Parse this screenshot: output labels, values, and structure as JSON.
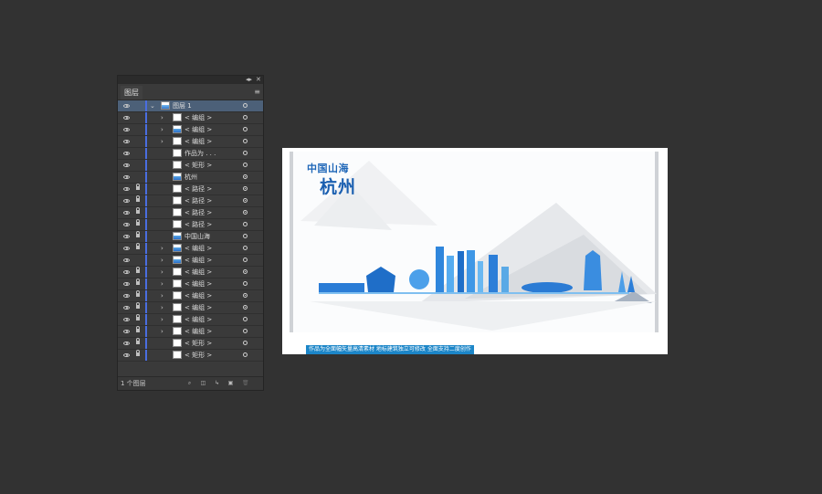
{
  "panel": {
    "tab_label": "图层",
    "collapse_icon": "double-arrow-icon",
    "close_icon": "close-icon",
    "menu_icon": "hamburger-menu-icon",
    "footer_count": "1 个图层",
    "footer_buttons": [
      "locate-object-icon",
      "make-clipping-mask-icon",
      "create-sublayer-icon",
      "new-layer-icon",
      "trash-icon"
    ]
  },
  "layers": [
    {
      "name": "图层 1",
      "top": true,
      "lock": false,
      "thumb": "blue",
      "twirl": "⌄",
      "target": "open",
      "selected": true
    },
    {
      "name": "< 编组 >",
      "lock": false,
      "thumb": "plain",
      "twirl": "›",
      "target": "open"
    },
    {
      "name": "< 编组 >",
      "lock": false,
      "thumb": "blue",
      "twirl": "›",
      "target": "open"
    },
    {
      "name": "< 编组 >",
      "lock": false,
      "thumb": "plain",
      "twirl": "›",
      "target": "open"
    },
    {
      "name": "作品为 . . .",
      "lock": false,
      "thumb": "plain",
      "twirl": "",
      "target": "open"
    },
    {
      "name": "< 矩形 >",
      "lock": false,
      "thumb": "plain",
      "twirl": "",
      "target": "open"
    },
    {
      "name": "杭州",
      "lock": false,
      "thumb": "blue",
      "twirl": "",
      "target": "filled"
    },
    {
      "name": "< 路径 >",
      "lock": true,
      "thumb": "plain",
      "twirl": "",
      "target": "filled"
    },
    {
      "name": "< 路径 >",
      "lock": true,
      "thumb": "plain",
      "twirl": "",
      "target": "filled"
    },
    {
      "name": "< 路径 >",
      "lock": true,
      "thumb": "plain",
      "twirl": "",
      "target": "filled"
    },
    {
      "name": "< 路径 >",
      "lock": true,
      "thumb": "plain",
      "twirl": "",
      "target": "open"
    },
    {
      "name": "中国山海",
      "lock": true,
      "thumb": "blue",
      "twirl": "",
      "target": "open"
    },
    {
      "name": "< 编组 >",
      "lock": true,
      "thumb": "blue",
      "twirl": "›",
      "target": "open"
    },
    {
      "name": "< 编组 >",
      "lock": false,
      "thumb": "blue",
      "twirl": "›",
      "target": "open"
    },
    {
      "name": "< 编组 >",
      "lock": true,
      "thumb": "plain",
      "twirl": "›",
      "target": "filled"
    },
    {
      "name": "< 编组 >",
      "lock": true,
      "thumb": "plain",
      "twirl": "›",
      "target": "open"
    },
    {
      "name": "< 编组 >",
      "lock": true,
      "thumb": "plain",
      "twirl": "›",
      "target": "filled"
    },
    {
      "name": "< 编组 >",
      "lock": true,
      "thumb": "plain",
      "twirl": "›",
      "target": "filled"
    },
    {
      "name": "< 编组 >",
      "lock": true,
      "thumb": "plain",
      "twirl": "›",
      "target": "open"
    },
    {
      "name": "< 编组 >",
      "lock": true,
      "thumb": "plain",
      "twirl": "›",
      "target": "open"
    },
    {
      "name": "< 矩形 >",
      "lock": true,
      "thumb": "plain",
      "twirl": "",
      "target": "open"
    },
    {
      "name": "< 矩形 >",
      "lock": true,
      "thumb": "plain",
      "twirl": "",
      "target": "open"
    }
  ],
  "artboard": {
    "title_small": "中国山海",
    "title_big": "杭州",
    "banner": "作品为全面幅矢量高清素材 地标建筑独立可修改 全面支持二度创作",
    "colors": {
      "brand_blue": "#1e66b8",
      "light_blue": "#5aa9e6",
      "banner": "#1c86c8",
      "mountain": "#d3d6da"
    }
  }
}
